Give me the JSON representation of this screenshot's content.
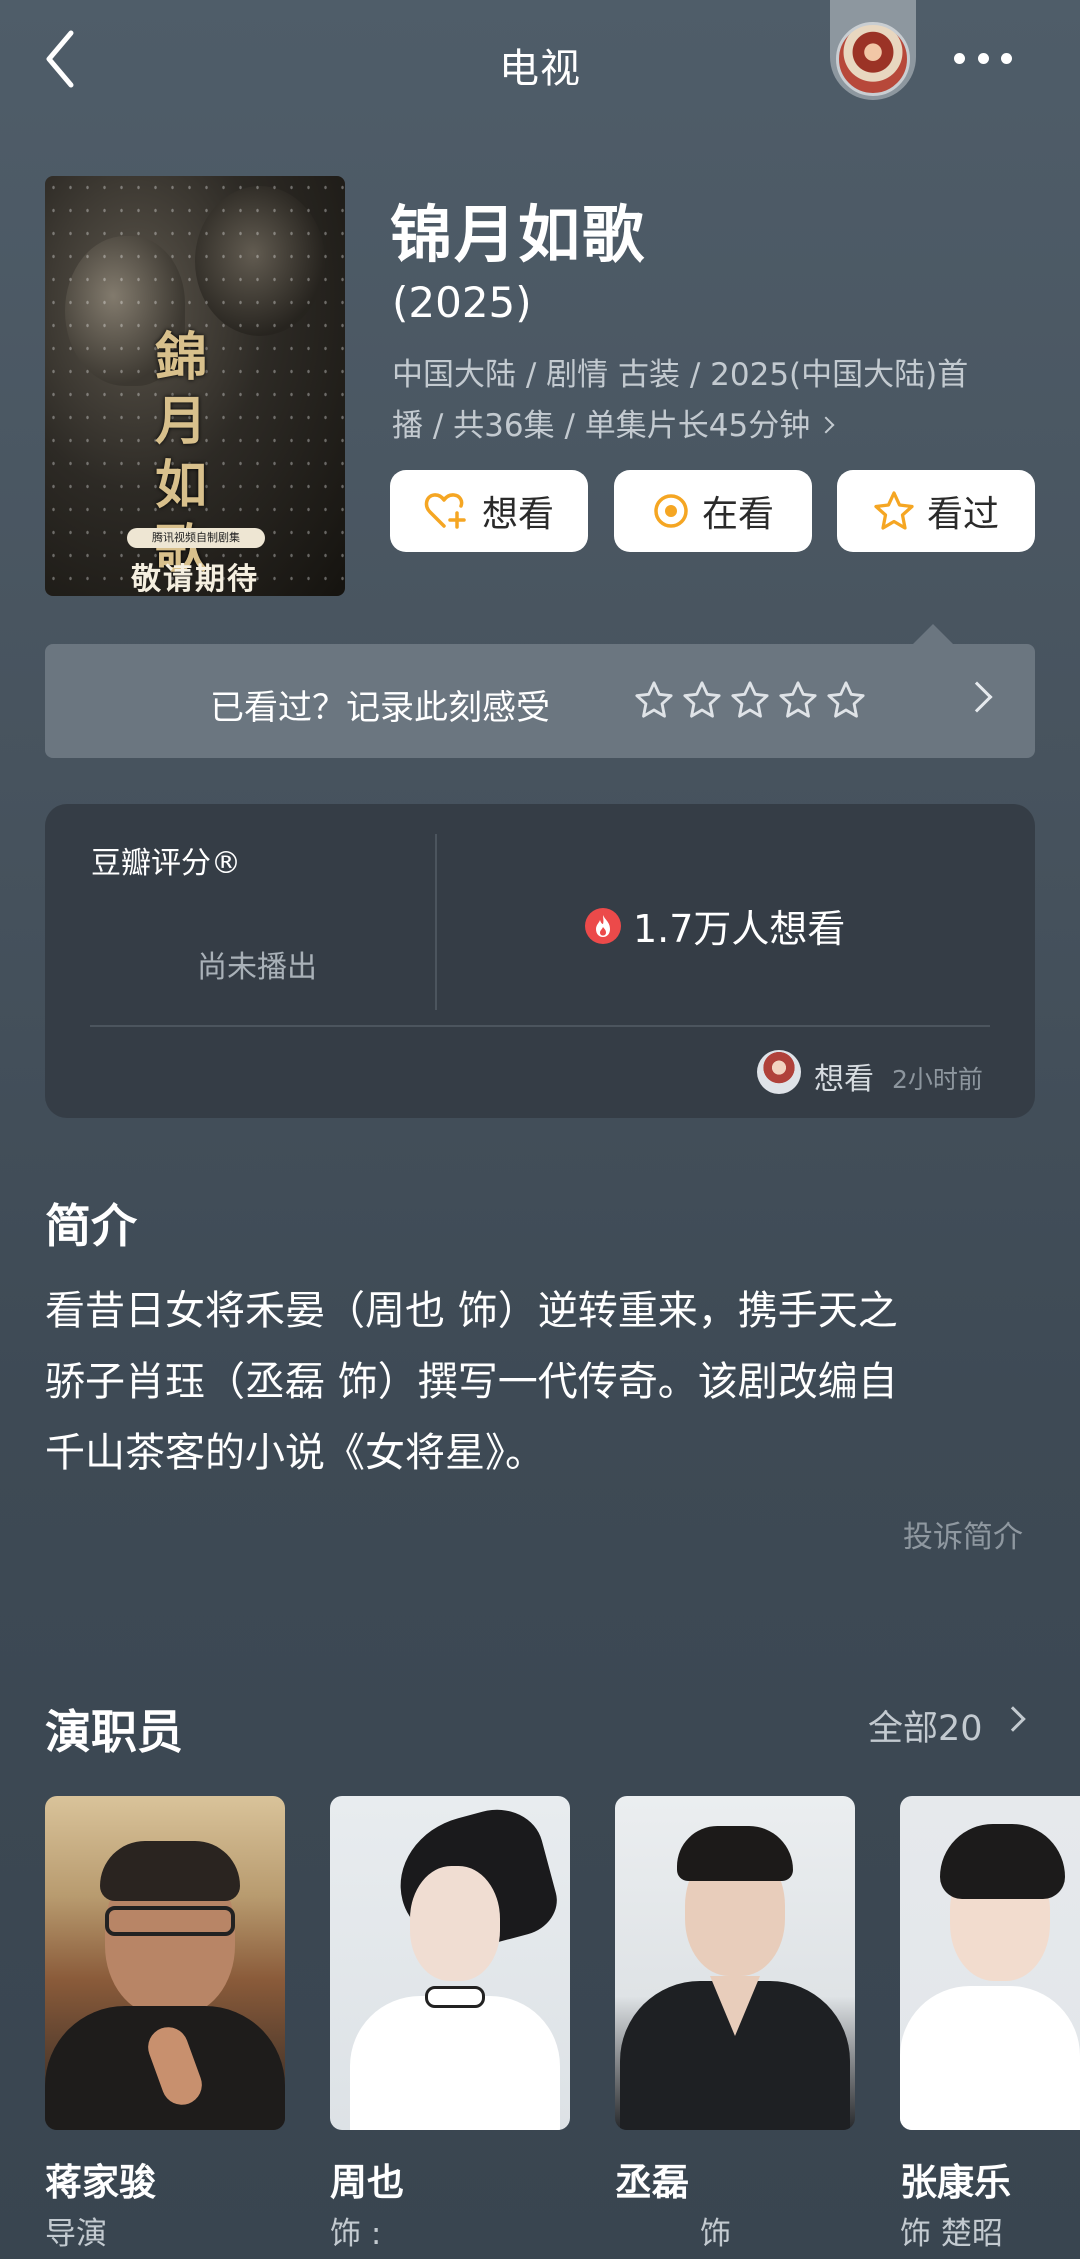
{
  "header": {
    "title": "电视"
  },
  "show": {
    "title": "锦月如歌",
    "year": "(2025)",
    "meta_line1": "中国大陆 / 剧情 古装 / 2025(中国大陆)首",
    "meta_line2": "播 / 共36集 / 单集片长45分钟",
    "poster": {
      "calligraphy": "錦月如歌",
      "badge": "腾讯视频自制剧集",
      "tagline": "敬请期待"
    }
  },
  "actions": {
    "want": "想看",
    "watching": "在看",
    "watched": "看过"
  },
  "record_bar": {
    "text": "已看过？记录此刻感受",
    "stars": 5
  },
  "rating": {
    "label": "豆瓣评分®",
    "status": "尚未播出",
    "want_count": "1.7万人想看",
    "activity_action": "想看",
    "activity_time": "2小时前"
  },
  "intro": {
    "title": "简介",
    "line1": "看昔日女将禾晏（周也 饰）逆转重来，携手天之",
    "line2": "骄子肖珏（丞磊 饰）撰写一代传奇。该剧改编自",
    "line3": "千山茶客的小说《女将星》。",
    "report": "投诉简介"
  },
  "cast": {
    "title": "演职员",
    "all_label": "全部20",
    "members": [
      {
        "name": "蒋家骏",
        "role": "导演"
      },
      {
        "name": "周也",
        "role": "饰 :"
      },
      {
        "name": "丞磊",
        "role": "饰"
      },
      {
        "name": "张康乐",
        "role": "饰 楚昭"
      }
    ]
  },
  "colors": {
    "accent_orange": "#f5a623",
    "fire_red": "#ec4a4a"
  }
}
